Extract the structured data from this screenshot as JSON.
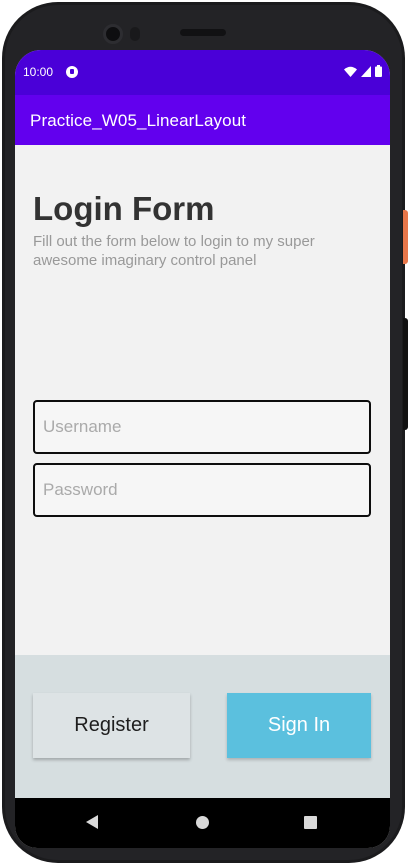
{
  "status_bar": {
    "time": "10:00",
    "icons": [
      "app-notification-icon",
      "wifi-icon",
      "signal-icon",
      "battery-icon"
    ]
  },
  "app_bar": {
    "title": "Practice_W05_LinearLayout"
  },
  "form": {
    "title": "Login Form",
    "subtitle": "Fill out the form below to login to my super awesome imaginary control panel",
    "username": {
      "value": "",
      "placeholder": "Username"
    },
    "password": {
      "value": "",
      "placeholder": "Password"
    }
  },
  "buttons": {
    "register_label": "Register",
    "signin_label": "Sign In"
  },
  "navigation": {
    "icons": [
      "back-icon",
      "home-icon",
      "recents-icon"
    ]
  },
  "colors": {
    "status_bar": "#4a00d8",
    "app_bar": "#6200ee",
    "content_bg": "#f2f2f2",
    "footer_bg": "#d6dee0",
    "register_bg": "#dde3e5",
    "signin_bg": "#5bc0de"
  }
}
